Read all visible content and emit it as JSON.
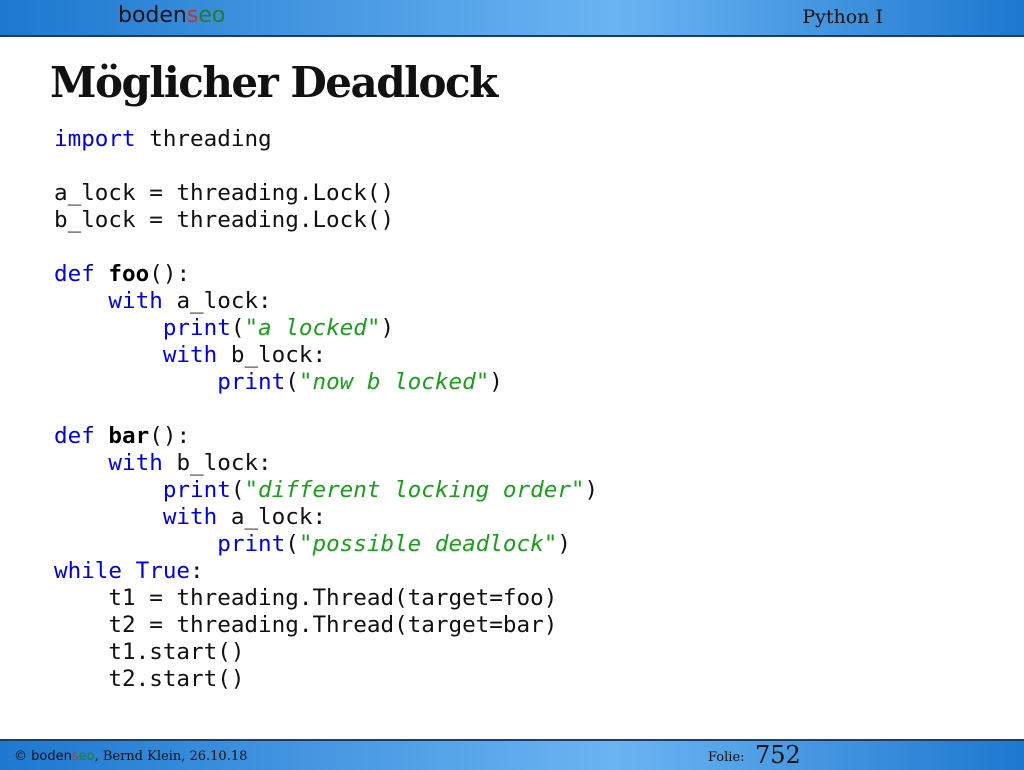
{
  "header": {
    "logo_prefix": "boden",
    "logo_s": "s",
    "logo_eo": "eo",
    "course": "Python I"
  },
  "slide": {
    "title": "Möglicher Deadlock"
  },
  "code": {
    "lines": [
      [
        {
          "t": "import",
          "c": "kw"
        },
        {
          "t": " threading",
          "c": ""
        }
      ],
      [],
      [
        {
          "t": "a_lock = threading.Lock()",
          "c": ""
        }
      ],
      [
        {
          "t": "b_lock = threading.Lock()",
          "c": ""
        }
      ],
      [],
      [
        {
          "t": "def",
          "c": "kw"
        },
        {
          "t": " ",
          "c": ""
        },
        {
          "t": "foo",
          "c": "fn"
        },
        {
          "t": "():",
          "c": ""
        }
      ],
      [
        {
          "t": "    ",
          "c": ""
        },
        {
          "t": "with",
          "c": "kw"
        },
        {
          "t": " a_lock:",
          "c": ""
        }
      ],
      [
        {
          "t": "        ",
          "c": ""
        },
        {
          "t": "print",
          "c": "kw"
        },
        {
          "t": "(",
          "c": ""
        },
        {
          "t": "\"a locked\"",
          "c": "str"
        },
        {
          "t": ")",
          "c": ""
        }
      ],
      [
        {
          "t": "        ",
          "c": ""
        },
        {
          "t": "with",
          "c": "kw"
        },
        {
          "t": " b_lock:",
          "c": ""
        }
      ],
      [
        {
          "t": "            ",
          "c": ""
        },
        {
          "t": "print",
          "c": "kw"
        },
        {
          "t": "(",
          "c": ""
        },
        {
          "t": "\"now b locked\"",
          "c": "str"
        },
        {
          "t": ")",
          "c": ""
        }
      ],
      [],
      [
        {
          "t": "def",
          "c": "kw"
        },
        {
          "t": " ",
          "c": ""
        },
        {
          "t": "bar",
          "c": "fn"
        },
        {
          "t": "():",
          "c": ""
        }
      ],
      [
        {
          "t": "    ",
          "c": ""
        },
        {
          "t": "with",
          "c": "kw"
        },
        {
          "t": " b_lock:",
          "c": ""
        }
      ],
      [
        {
          "t": "        ",
          "c": ""
        },
        {
          "t": "print",
          "c": "kw"
        },
        {
          "t": "(",
          "c": ""
        },
        {
          "t": "\"different locking order\"",
          "c": "str"
        },
        {
          "t": ")",
          "c": ""
        }
      ],
      [
        {
          "t": "        ",
          "c": ""
        },
        {
          "t": "with",
          "c": "kw"
        },
        {
          "t": " a_lock:",
          "c": ""
        }
      ],
      [
        {
          "t": "            ",
          "c": ""
        },
        {
          "t": "print",
          "c": "kw"
        },
        {
          "t": "(",
          "c": ""
        },
        {
          "t": "\"possible deadlock\"",
          "c": "str"
        },
        {
          "t": ")",
          "c": ""
        }
      ],
      [
        {
          "t": "while",
          "c": "kw"
        },
        {
          "t": " ",
          "c": ""
        },
        {
          "t": "True",
          "c": "kw"
        },
        {
          "t": ":",
          "c": ""
        }
      ],
      [
        {
          "t": "    t1 = threading.Thread(target=foo)",
          "c": ""
        }
      ],
      [
        {
          "t": "    t2 = threading.Thread(target=bar)",
          "c": ""
        }
      ],
      [
        {
          "t": "    t1.start()",
          "c": ""
        }
      ],
      [
        {
          "t": "    t2.start()",
          "c": ""
        }
      ]
    ]
  },
  "footer": {
    "copyright": "© ",
    "brand_prefix": "boden",
    "brand_s": "s",
    "brand_eo": "eo",
    "author_date": ", Bernd Klein, 26.10.18",
    "folie_label": "Folie:",
    "folie_number": "752"
  },
  "colors": {
    "bar_blue": "#1d78cf",
    "bar_light": "#6bb4f2",
    "keyword": "#0000ee",
    "string": "#19a019"
  }
}
